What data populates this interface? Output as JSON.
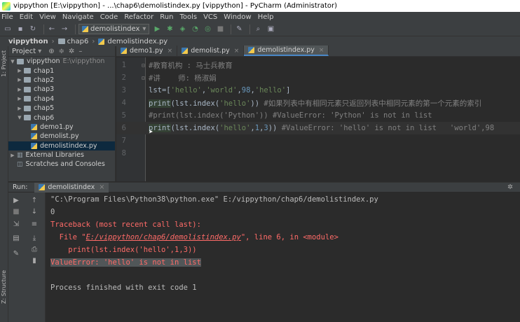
{
  "window": {
    "title": "vippython [E:\\vippython] - ...\\chap6\\demolistindex.py [vippython] - PyCharm (Administrator)"
  },
  "menu": [
    "File",
    "Edit",
    "View",
    "Navigate",
    "Code",
    "Refactor",
    "Run",
    "Tools",
    "VCS",
    "Window",
    "Help"
  ],
  "toolbar": {
    "run_config": "demolistindex"
  },
  "breadcrumb": [
    "vippython",
    "chap6",
    "demolistindex.py"
  ],
  "left_strip": {
    "project_label": "1: Project",
    "structure_label": "Z: Structure"
  },
  "project_panel": {
    "title": "Project",
    "root_name": "vippython",
    "root_path": "E:\\vippython",
    "folders": [
      "chap1",
      "chap2",
      "chap3",
      "chap4",
      "chap5",
      "chap6"
    ],
    "chap6_files": [
      "demo1.py",
      "demolist.py",
      "demolistindex.py"
    ],
    "external": "External Libraries",
    "scratches": "Scratches and Consoles"
  },
  "tabs": [
    {
      "label": "demo1.py",
      "active": false
    },
    {
      "label": "demolist.py",
      "active": false
    },
    {
      "label": "demolistindex.py",
      "active": true
    }
  ],
  "editor": {
    "line_numbers": [
      "1",
      "2",
      "3",
      "4",
      "5",
      "6",
      "7",
      "8"
    ],
    "line1": "#教育机构 : 马士兵教育",
    "line2": "#讲    师: 杨淑娟",
    "line3_a": "lst=[",
    "line3_s1": "'hello'",
    "line3_c1": ",",
    "line3_s2": "'world'",
    "line3_c2": ",",
    "line3_n": "98",
    "line3_c3": ",",
    "line3_s3": "'hello'",
    "line3_e": "]",
    "line4_fn": "print",
    "line4_a": "(lst.index(",
    "line4_s": "'hello'",
    "line4_b": "))",
    "line4_cmt": " #如果列表中有相同元素只返回列表中相同元素的第一个元素的索引",
    "line5": "#print(lst.index('Python')) #ValueError: 'Python' is not in list",
    "line6_fn": "print",
    "line6_a": "(lst.index(",
    "line6_s": "'hello'",
    "line6_c1": ",",
    "line6_n1": "1",
    "line6_c2": ",",
    "line6_n2": "3",
    "line6_b": "))",
    "line6_cmt": " #ValueError: 'hello' is not in list   'world',98"
  },
  "run": {
    "label": "Run:",
    "tab": "demolistindex",
    "lines": {
      "cmd": "\"C:\\Program Files\\Python38\\python.exe\" E:/vippython/chap6/demolistindex.py",
      "out": "0",
      "tb": "Traceback (most recent call last):",
      "file_pre": "  File \"",
      "file_link": "E:/vippython/chap6/demolistindex.py",
      "file_post": "\", line 6, in <module>",
      "src": "    print(lst.index('hello',1,3))",
      "err": "ValueError: 'hello' is not in list",
      "done": "Process finished with exit code 1"
    }
  }
}
